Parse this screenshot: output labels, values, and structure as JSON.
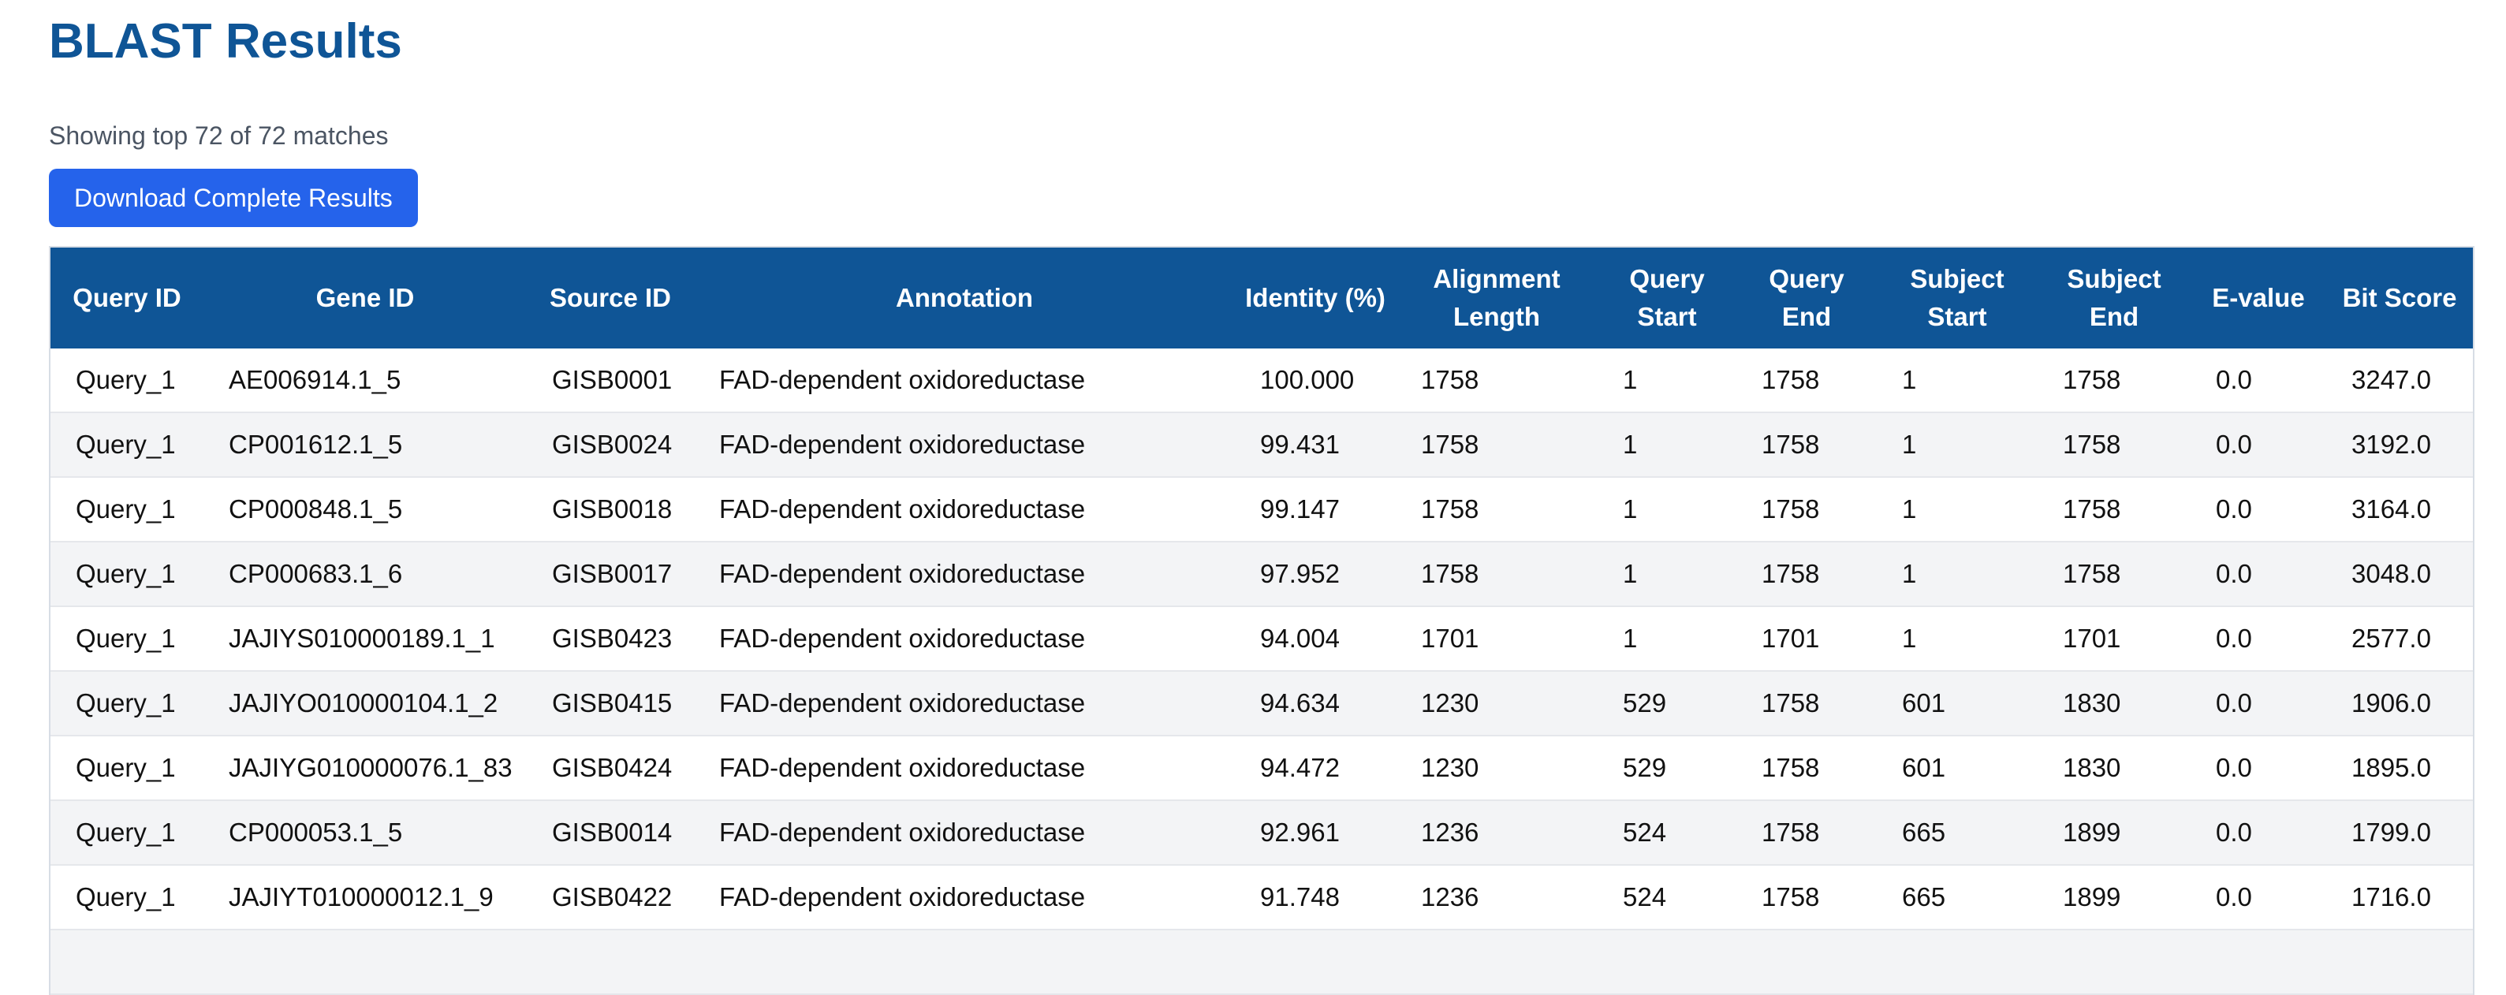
{
  "page": {
    "title": "BLAST Results",
    "summary": "Showing top 72 of 72 matches",
    "download_label": "Download Complete Results"
  },
  "colors": {
    "title": "#0f5596",
    "header_bg": "#0f5596",
    "button_bg": "#2563eb",
    "row_alt_bg": "#f3f4f6"
  },
  "table": {
    "columns": [
      {
        "key": "query_id",
        "label": "Query ID"
      },
      {
        "key": "gene_id",
        "label": "Gene ID"
      },
      {
        "key": "source_id",
        "label": "Source ID"
      },
      {
        "key": "annotation",
        "label": "Annotation"
      },
      {
        "key": "identity",
        "label": "Identity (%)"
      },
      {
        "key": "alignment_length",
        "label": "Alignment Length"
      },
      {
        "key": "query_start",
        "label": "Query Start"
      },
      {
        "key": "query_end",
        "label": "Query End"
      },
      {
        "key": "subject_start",
        "label": "Subject Start"
      },
      {
        "key": "subject_end",
        "label": "Subject End"
      },
      {
        "key": "evalue",
        "label": "E-value"
      },
      {
        "key": "bit_score",
        "label": "Bit Score"
      }
    ],
    "rows": [
      [
        "Query_1",
        "AE006914.1_5",
        "GISB0001",
        "FAD-dependent oxidoreductase",
        "100.000",
        "1758",
        "1",
        "1758",
        "1",
        "1758",
        "0.0",
        "3247.0"
      ],
      [
        "Query_1",
        "CP001612.1_5",
        "GISB0024",
        "FAD-dependent oxidoreductase",
        "99.431",
        "1758",
        "1",
        "1758",
        "1",
        "1758",
        "0.0",
        "3192.0"
      ],
      [
        "Query_1",
        "CP000848.1_5",
        "GISB0018",
        "FAD-dependent oxidoreductase",
        "99.147",
        "1758",
        "1",
        "1758",
        "1",
        "1758",
        "0.0",
        "3164.0"
      ],
      [
        "Query_1",
        "CP000683.1_6",
        "GISB0017",
        "FAD-dependent oxidoreductase",
        "97.952",
        "1758",
        "1",
        "1758",
        "1",
        "1758",
        "0.0",
        "3048.0"
      ],
      [
        "Query_1",
        "JAJIYS010000189.1_1",
        "GISB0423",
        "FAD-dependent oxidoreductase",
        "94.004",
        "1701",
        "1",
        "1701",
        "1",
        "1701",
        "0.0",
        "2577.0"
      ],
      [
        "Query_1",
        "JAJIYO010000104.1_2",
        "GISB0415",
        "FAD-dependent oxidoreductase",
        "94.634",
        "1230",
        "529",
        "1758",
        "601",
        "1830",
        "0.0",
        "1906.0"
      ],
      [
        "Query_1",
        "JAJIYG010000076.1_83",
        "GISB0424",
        "FAD-dependent oxidoreductase",
        "94.472",
        "1230",
        "529",
        "1758",
        "601",
        "1830",
        "0.0",
        "1895.0"
      ],
      [
        "Query_1",
        "CP000053.1_5",
        "GISB0014",
        "FAD-dependent oxidoreductase",
        "92.961",
        "1236",
        "524",
        "1758",
        "665",
        "1899",
        "0.0",
        "1799.0"
      ],
      [
        "Query_1",
        "JAJIYT010000012.1_9",
        "GISB0422",
        "FAD-dependent oxidoreductase",
        "91.748",
        "1236",
        "524",
        "1758",
        "665",
        "1899",
        "0.0",
        "1716.0"
      ],
      [
        "",
        "",
        "",
        "",
        "",
        "",
        "",
        "",
        "",
        "",
        "",
        ""
      ]
    ]
  }
}
